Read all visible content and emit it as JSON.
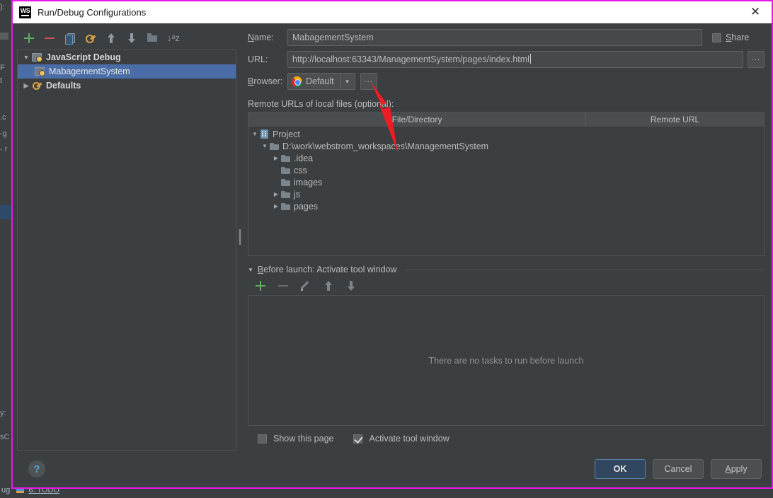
{
  "window": {
    "title": "Run/Debug Configurations",
    "app_icon": "webstorm-ws-icon",
    "close_icon": "✕"
  },
  "tree_toolbar": {
    "icons": [
      {
        "name": "add-icon",
        "glyph": "+"
      },
      {
        "name": "remove-icon",
        "glyph": "−"
      },
      {
        "name": "copy-icon",
        "glyph": "copy"
      },
      {
        "name": "edit-defaults-icon",
        "glyph": "wrench"
      },
      {
        "name": "move-up-icon",
        "glyph": "↑"
      },
      {
        "name": "move-down-icon",
        "glyph": "↓"
      },
      {
        "name": "folder-icon",
        "glyph": "folder"
      },
      {
        "name": "sort-alphabetically-icon",
        "glyph": "↓az"
      }
    ],
    "sort_glyph": "↓ᵃz"
  },
  "tree": {
    "nodes": [
      {
        "label": "JavaScript Debug",
        "twisty": "▼",
        "icon": "js-debug-icon",
        "bold": true,
        "selected": false
      },
      {
        "label": "MabagementSystem",
        "twisty": "",
        "icon": "js-debug-icon",
        "bold": false,
        "selected": true
      },
      {
        "label": "Defaults",
        "twisty": "▶",
        "icon": "defaults-wrench-icon",
        "bold": true,
        "selected": false
      }
    ]
  },
  "form": {
    "name_label": "Name:",
    "name_label_mnemonic": "N",
    "name_value": "MabagementSystem",
    "url_label": "URL:",
    "url_value": "http://localhost:63343/ManagementSystem/pages/index.html",
    "url_browse_label": "...",
    "browser_label": "Browser:",
    "browser_label_mnemonic": "B",
    "browser_value": "Default",
    "browser_icon": "chrome-icon",
    "browser_dropdown_glyph": "▼",
    "browser_browse_label": "...",
    "share_label": "Share",
    "share_label_mnemonic": "S",
    "share_checked": false
  },
  "remote_urls": {
    "section_label": "Remote URLs of local files (optional):",
    "columns": [
      "File/Directory",
      "Remote URL"
    ],
    "rows": [
      {
        "label": "Project",
        "twisty": "▼",
        "icon": "project-icon",
        "indent": 0,
        "remote_url": ""
      },
      {
        "label": "D:\\work\\webstrom_workspaces\\ManagementSystem",
        "twisty": "▼",
        "icon": "folder-icon",
        "indent": 1,
        "remote_url": ""
      },
      {
        "label": ".idea",
        "twisty": "▶",
        "icon": "folder-icon",
        "indent": 2,
        "remote_url": ""
      },
      {
        "label": "css",
        "twisty": "",
        "icon": "folder-icon",
        "indent": 2,
        "remote_url": ""
      },
      {
        "label": "images",
        "twisty": "",
        "icon": "folder-icon",
        "indent": 2,
        "remote_url": ""
      },
      {
        "label": "js",
        "twisty": "▶",
        "icon": "folder-icon",
        "indent": 2,
        "remote_url": ""
      },
      {
        "label": "pages",
        "twisty": "▶",
        "icon": "folder-icon",
        "indent": 2,
        "remote_url": ""
      }
    ]
  },
  "before_launch": {
    "twisty": "▼",
    "title": "Before launch: Activate tool window",
    "title_mnemonic": "B",
    "toolbar_icons": [
      {
        "name": "add-task-icon",
        "glyph": "+"
      },
      {
        "name": "remove-task-icon",
        "glyph": "−"
      },
      {
        "name": "edit-task-icon",
        "glyph": "pencil"
      },
      {
        "name": "move-task-up-icon",
        "glyph": "↑"
      },
      {
        "name": "move-task-down-icon",
        "glyph": "↓"
      }
    ],
    "empty_text": "There are no tasks to run before launch",
    "show_page_label": "Show this page",
    "show_page_checked": false,
    "activate_tool_window_label": "Activate tool window",
    "activate_tool_window_checked": true
  },
  "footer": {
    "help_glyph": "?",
    "ok_label": "OK",
    "cancel_label": "Cancel",
    "apply_label": "Apply",
    "apply_mnemonic": "A"
  },
  "ide_background": {
    "bottom_status": "ug",
    "bottom_todo": "6: TODO",
    "left_fragments": [
      "): ",
      "F",
      "t",
      ".c",
      "-g",
      "- r",
      "y:",
      "sC"
    ]
  },
  "colors": {
    "dialog_bg": "#3c3f41",
    "titlebar_bg": "#ffffff",
    "selection_blue": "#4a6da7",
    "accent_green": "#5fad5f",
    "accent_red": "#c75450",
    "default_button": "#31475f",
    "annotation_magenta": "#e818e8",
    "annotation_red": "#ee1c25",
    "text_primary": "#bbbbbb"
  }
}
